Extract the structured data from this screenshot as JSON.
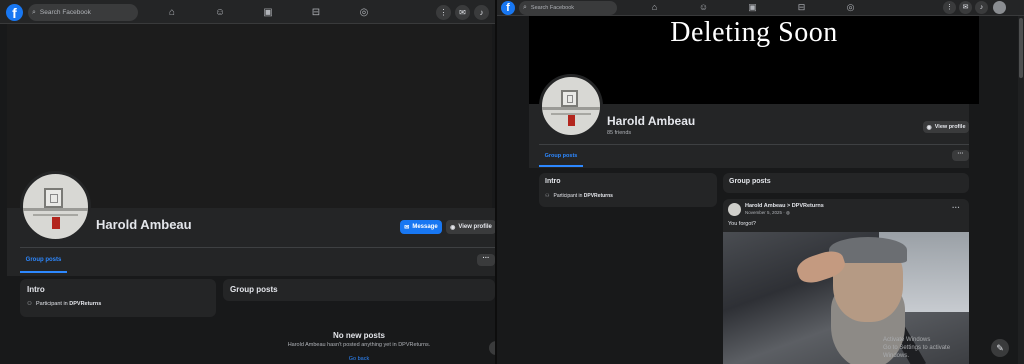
{
  "left": {
    "search": {
      "placeholder": "Search Facebook"
    },
    "profile": {
      "name": "Harold Ambeau"
    },
    "buttons": {
      "message": "Message",
      "view_profile": "View profile"
    },
    "tabs": {
      "group_posts": "Group posts"
    },
    "intro": {
      "title": "Intro",
      "participant_prefix": "Participant in",
      "group": "DPVReturns"
    },
    "group_posts": {
      "title": "Group posts"
    },
    "empty": {
      "title": "No new posts",
      "subtitle": "Harold Ambeau hasn't posted anything yet in DPVReturns.",
      "link": "Go back"
    }
  },
  "right": {
    "search": {
      "placeholder": "Search Facebook"
    },
    "cover": {
      "text": "Deleting Soon"
    },
    "profile": {
      "name": "Harold Ambeau",
      "friends": "85 friends"
    },
    "buttons": {
      "view_profile": "View profile"
    },
    "tabs": {
      "group_posts": "Group posts"
    },
    "intro": {
      "title": "Intro",
      "participant_prefix": "Participant in",
      "group": "DPVReturns"
    },
    "group_posts": {
      "title": "Group posts"
    },
    "post": {
      "author": "Harold Ambeau > DPVReturns",
      "date": "November 5, 2025 · ",
      "text": "You forgot?"
    },
    "watermark": {
      "line1": "Activate Windows",
      "line2": "Go to Settings to activate Windows."
    }
  },
  "colors": {
    "accent": "#1877f2",
    "link": "#2d88ff",
    "background": "#18191a",
    "card": "#242526"
  },
  "icons": [
    "facebook-logo",
    "search-icon",
    "home-icon",
    "friends-icon",
    "video-icon",
    "marketplace-icon",
    "gaming-icon",
    "menu-grid-icon",
    "messenger-icon",
    "bell-icon",
    "group-icon",
    "globe-icon",
    "compose-icon"
  ]
}
